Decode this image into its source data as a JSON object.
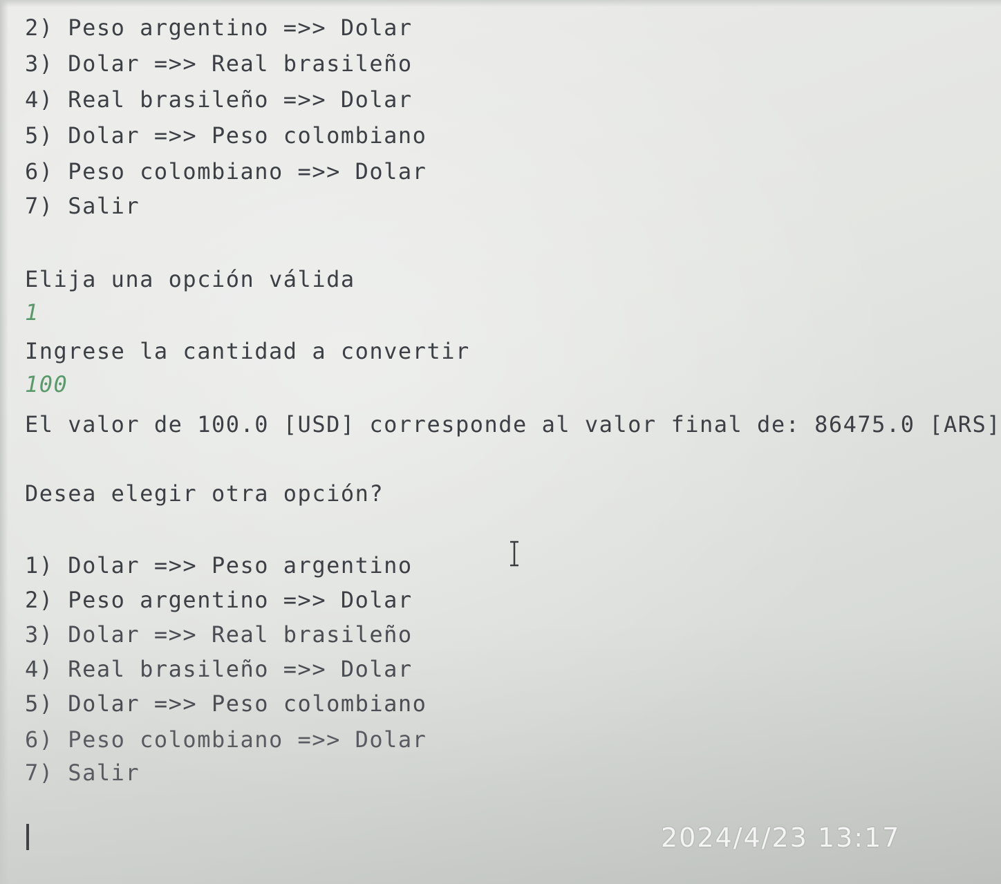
{
  "console": {
    "lines_top": [
      "2) Peso argentino =>> Dolar",
      "3) Dolar =>> Real brasileño",
      "4) Real brasileño =>> Dolar",
      "5) Dolar =>> Peso colombiano",
      "6) Peso colombiano =>> Dolar",
      "7) Salir"
    ],
    "prompt_option": "Elija una opción válida",
    "input_option": "1",
    "prompt_amount": "Ingrese la cantidad a convertir",
    "input_amount": "100",
    "result": "El valor de 100.0 [USD] corresponde al valor final de: 86475.0 [ARS]",
    "prompt_again": "Desea elegir otra opción?",
    "menu": [
      "1) Dolar =>> Peso argentino",
      "2) Peso argentino =>> Dolar",
      "3) Dolar =>> Real brasileño",
      "4) Real brasileño =>> Dolar",
      "5) Dolar =>> Peso colombiano",
      "6) Peso colombiano =>> Dolar",
      "7) Salir"
    ]
  },
  "photo_timestamp": "2024/4/23 13:17",
  "icons": {
    "text_cursor": "i-beam-cursor-icon",
    "input_caret": "text-caret-icon"
  },
  "colors": {
    "console_text": "#3c3f44",
    "user_input": "#5a9a6a",
    "timestamp": "#f4f4f4"
  }
}
